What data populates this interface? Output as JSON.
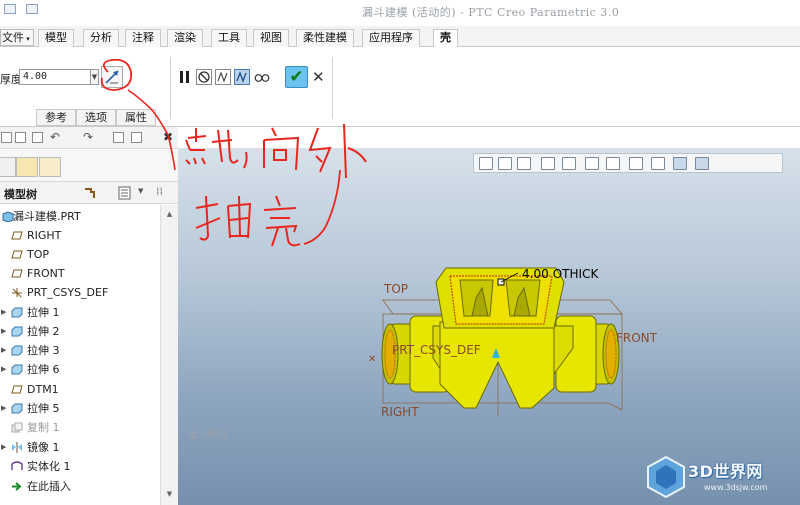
{
  "window": {
    "title": "漏斗建模 (活动的) - PTC Creo Parametric 3.0"
  },
  "ribbon_tabs": {
    "file": "文件",
    "items": [
      {
        "label": "模型"
      },
      {
        "label": "分析"
      },
      {
        "label": "注释"
      },
      {
        "label": "渲染"
      },
      {
        "label": "工具"
      },
      {
        "label": "视图"
      },
      {
        "label": "柔性建模"
      },
      {
        "label": "应用程序"
      },
      {
        "label": "壳",
        "active": true
      }
    ]
  },
  "shell_dashboard": {
    "thickness_label": "厚度",
    "thickness_value": "4.00",
    "flip_icon": "flip-direction-icon",
    "controls": [
      {
        "icon": "pause-icon"
      },
      {
        "icon": "no-preview-icon"
      },
      {
        "icon": "verification-preview-icon"
      },
      {
        "icon": "geometry-preview-icon",
        "active": true
      },
      {
        "icon": "glasses-preview-icon"
      }
    ],
    "ok_icon": "checkmark-icon",
    "cancel_icon": "close-icon",
    "subtabs": [
      "参考",
      "选项",
      "属性"
    ]
  },
  "model_tree": {
    "header": "模型树",
    "items": [
      {
        "label": "漏斗建模.PRT",
        "icon": "part-icon",
        "expandable": false
      },
      {
        "label": "RIGHT",
        "icon": "datum-plane-icon",
        "expandable": false
      },
      {
        "label": "TOP",
        "icon": "datum-plane-icon",
        "expandable": false
      },
      {
        "label": "FRONT",
        "icon": "datum-plane-icon",
        "expandable": false
      },
      {
        "label": "PRT_CSYS_DEF",
        "icon": "coordinate-system-icon",
        "expandable": false
      },
      {
        "label": "拉伸 1",
        "icon": "extrude-icon",
        "expandable": true
      },
      {
        "label": "拉伸 2",
        "icon": "extrude-icon",
        "expandable": true
      },
      {
        "label": "拉伸 3",
        "icon": "extrude-icon",
        "expandable": true
      },
      {
        "label": "拉伸 6",
        "icon": "extrude-icon",
        "expandable": true
      },
      {
        "label": "DTM1",
        "icon": "datum-plane-icon",
        "expandable": false
      },
      {
        "label": "拉伸 5",
        "icon": "extrude-icon",
        "expandable": true
      },
      {
        "label": "复制 1",
        "icon": "copy-icon",
        "expandable": false,
        "dim": true
      },
      {
        "label": "镜像 1",
        "icon": "mirror-icon",
        "expandable": true
      },
      {
        "label": "实体化 1",
        "icon": "solidify-icon",
        "expandable": false
      },
      {
        "label": "在此插入",
        "icon": "insert-here-icon",
        "expandable": false
      }
    ]
  },
  "viewport": {
    "plane_labels": {
      "top": "TOP",
      "front": "FRONT",
      "right": "RIGHT",
      "csys": "PRT_CSYS_DEF"
    },
    "dimension": {
      "value": "4.00",
      "symbol": "O",
      "type": "THICK"
    },
    "mode_text": "插入模式",
    "watermark": {
      "text": "3D世界网",
      "url": "www.3dsjw.com"
    },
    "model_color": "#e6e600",
    "annotation": {
      "line1": "点击,向外",
      "line2": "抽壳",
      "color": "#e8261e"
    }
  }
}
